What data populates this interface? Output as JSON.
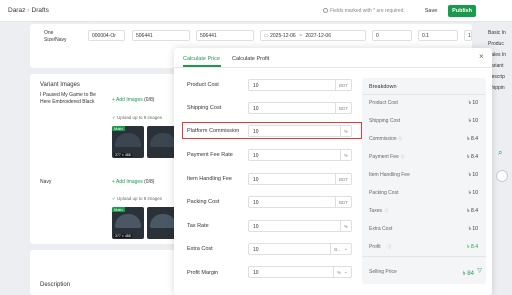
{
  "header": {
    "breadcrumb": [
      "Daraz",
      "Drafts"
    ],
    "required_note": "Fields marked with * are required.",
    "save_label": "Save",
    "publish_label": "Publish"
  },
  "variant_row": {
    "label_line1": "One",
    "label_line2": "Size/Navy",
    "fields": [
      "000004-Or",
      "506441",
      "506441"
    ],
    "date_start": "2025-12-06",
    "date_sep": "~",
    "date_end": "2027-12-06",
    "qty": "0",
    "val1": "0.1",
    "val2": "1"
  },
  "variant_images": {
    "title": "Variant Images",
    "variant1_name": "I Paused My Game to Be Here Embroidered Black",
    "add_images": "Add Images",
    "count": "(0/8)",
    "upload_note": "Upload up to 8 images",
    "main_badge": "Main",
    "size_badge": "377 × 488",
    "variant2_name": "Navy"
  },
  "description": {
    "title": "Description"
  },
  "sidebar": {
    "items": [
      "Basic In",
      "Produc",
      "Sales In",
      "Variant",
      "Descrip",
      "Shippin"
    ]
  },
  "modal": {
    "tabs": [
      "Calculate Price",
      "Calculate Profit"
    ],
    "close_glyph": "×",
    "fields": [
      {
        "label": "Product Cost",
        "value": "10",
        "unit": "BDT"
      },
      {
        "label": "Shipping Cost",
        "value": "10",
        "unit": "BDT"
      },
      {
        "label": "Platform Commission",
        "value": "10",
        "unit": "%"
      },
      {
        "label": "Payment Fee Rate",
        "value": "10",
        "unit": "%"
      },
      {
        "label": "Item Handling Fee",
        "value": "10",
        "unit": "BDT"
      },
      {
        "label": "Packing Cost",
        "value": "10",
        "unit": "BDT"
      },
      {
        "label": "Tax Rate",
        "value": "10",
        "unit": "%"
      },
      {
        "label": "Extra Cost",
        "value": "10",
        "unit": "B..."
      },
      {
        "label": "Profit Margin",
        "value": "10",
        "unit": "%"
      }
    ],
    "breakdown": {
      "title": "Breakdown",
      "rows": [
        {
          "label": "Product Cost",
          "value": "৳ 10",
          "info": false
        },
        {
          "label": "Shipping Cost",
          "value": "৳ 10",
          "info": false
        },
        {
          "label": "Commission",
          "value": "৳ 8.4",
          "info": true
        },
        {
          "label": "Payment Fee",
          "value": "৳ 8.4",
          "info": true
        },
        {
          "label": "Item Handling Fee",
          "value": "৳ 10",
          "info": false
        },
        {
          "label": "Packing Cost",
          "value": "৳ 10",
          "info": false
        },
        {
          "label": "Taxes",
          "value": "৳ 8.4",
          "info": true
        },
        {
          "label": "Extra Cost",
          "value": "৳ 10",
          "info": false
        },
        {
          "label": "Profit",
          "value": "৳ 8.4",
          "info": true
        }
      ],
      "selling_label": "Selling Price",
      "selling_value": "৳ 84"
    }
  },
  "colors": {
    "accent": "#1a9b4b",
    "highlight": "#e03c3c"
  }
}
